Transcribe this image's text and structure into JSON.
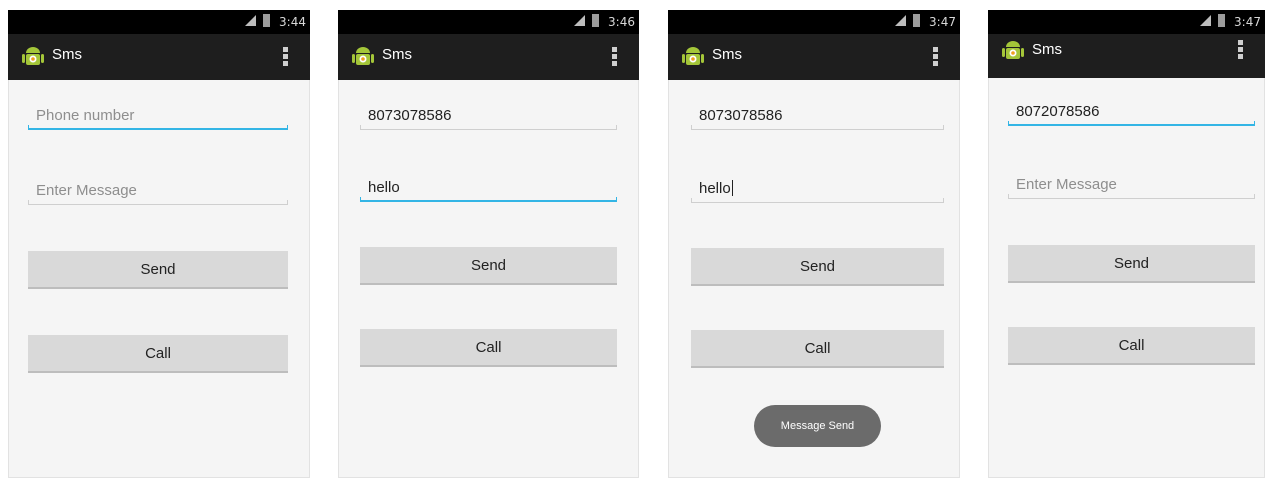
{
  "app": {
    "title": "Sms",
    "colors": {
      "action_bar": "#1e1e1e",
      "status_bar": "#000000",
      "focus_line": "#33b5e5",
      "button": "#d9d9d9",
      "toast": "#6b6b6b"
    },
    "icons": {
      "app": "android-robot-icon",
      "menu": "overflow-menu-icon",
      "signal": "signal-icon",
      "battery": "battery-icon"
    }
  },
  "screens": [
    {
      "time": "3:44",
      "phone_field": {
        "value": "",
        "placeholder": "Phone number",
        "focused": true
      },
      "message_field": {
        "value": "",
        "placeholder": "Enter Message",
        "focused": false
      },
      "send_label": "Send",
      "call_label": "Call"
    },
    {
      "time": "3:46",
      "phone_field": {
        "value": "8073078586",
        "placeholder": "Phone number",
        "focused": false
      },
      "message_field": {
        "value": "hello",
        "placeholder": "Enter Message",
        "focused": true
      },
      "send_label": "Send",
      "call_label": "Call"
    },
    {
      "time": "3:47",
      "phone_field": {
        "value": "8073078586",
        "placeholder": "Phone number",
        "focused": false
      },
      "message_field": {
        "value": "hello",
        "placeholder": "Enter Message",
        "focused": false,
        "caret": true
      },
      "send_label": "Send",
      "call_label": "Call",
      "toast": "Message Send"
    },
    {
      "time": "3:47",
      "phone_field": {
        "value": "8072078586",
        "placeholder": "Phone number",
        "focused": true
      },
      "message_field": {
        "value": "",
        "placeholder": "Enter Message",
        "focused": false
      },
      "send_label": "Send",
      "call_label": "Call"
    }
  ]
}
